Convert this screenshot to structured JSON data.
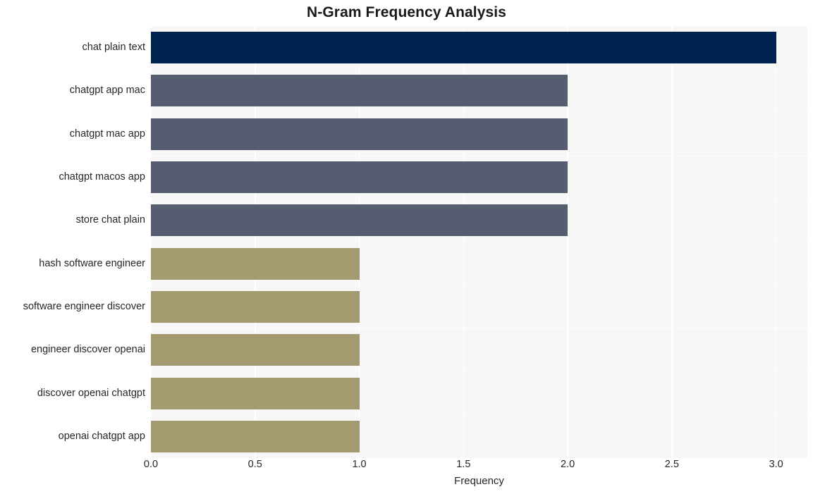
{
  "chart_data": {
    "type": "bar",
    "orientation": "horizontal",
    "title": "N-Gram Frequency Analysis",
    "xlabel": "Frequency",
    "ylabel": "",
    "xlim": [
      0,
      3.15
    ],
    "xticks": [
      "0.0",
      "0.5",
      "1.0",
      "1.5",
      "2.0",
      "2.5",
      "3.0"
    ],
    "xtick_values": [
      0,
      0.5,
      1,
      1.5,
      2,
      2.5,
      3
    ],
    "grid": true,
    "legend": "none",
    "categories": [
      "chat plain text",
      "chatgpt app mac",
      "chatgpt mac app",
      "chatgpt macos app",
      "store chat plain",
      "hash software engineer",
      "software engineer discover",
      "engineer discover openai",
      "discover openai chatgpt",
      "openai chatgpt app"
    ],
    "values": [
      3,
      2,
      2,
      2,
      2,
      1,
      1,
      1,
      1,
      1
    ],
    "bar_colors": [
      "#002350",
      "#575d70",
      "#575d70",
      "#575d70",
      "#575d70",
      "#a39a70",
      "#a39a70",
      "#a39a70",
      "#a39a70",
      "#a39a70"
    ],
    "plot_background": "#f7f7f7",
    "figure_background": "#ffffff",
    "gridline_color": "#ffffff",
    "title_color": "#1a1a1a",
    "text_color": "#262626"
  }
}
